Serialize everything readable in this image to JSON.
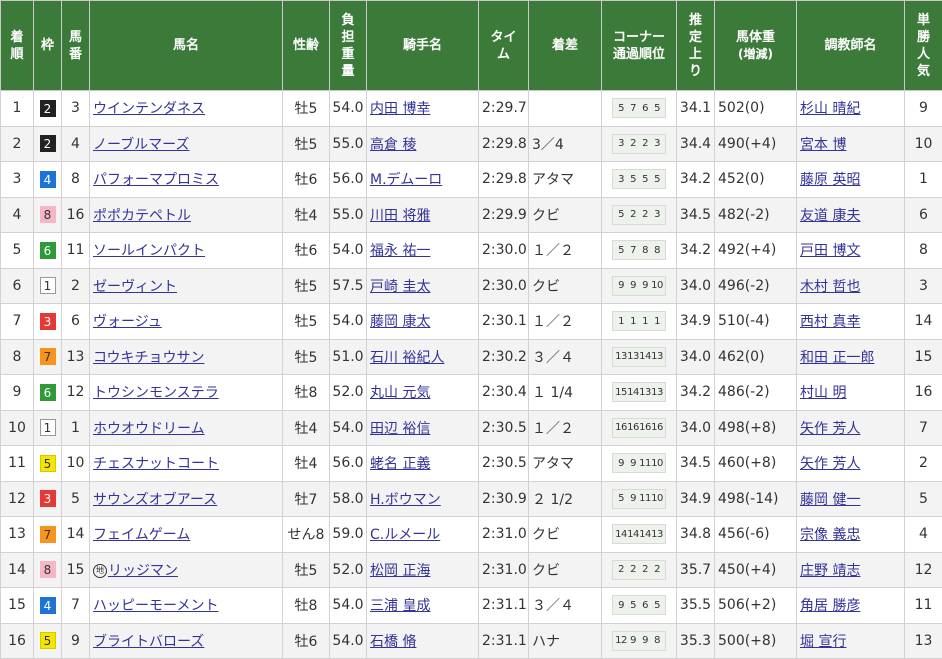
{
  "headers": [
    "着順",
    "枠",
    "馬番",
    "馬名",
    "性齢",
    "負担重量",
    "騎手名",
    "タイム",
    "着差",
    "コーナー通過順位",
    "推定上り",
    "馬体重(増減)",
    "調教師名",
    "単勝人気"
  ],
  "waku_colors": {
    "1": {
      "bg": "#ffffff",
      "fg": "#333333",
      "border": "#999999"
    },
    "2": {
      "bg": "#222222",
      "fg": "#ffffff",
      "border": "#222222"
    },
    "3": {
      "bg": "#e53935",
      "fg": "#ffffff",
      "border": "#e53935"
    },
    "4": {
      "bg": "#1e73d8",
      "fg": "#ffffff",
      "border": "#1e73d8"
    },
    "5": {
      "bg": "#f5e600",
      "fg": "#333333",
      "border": "#d6c800"
    },
    "6": {
      "bg": "#2e9a3a",
      "fg": "#ffffff",
      "border": "#2e9a3a"
    },
    "7": {
      "bg": "#f7941d",
      "fg": "#333333",
      "border": "#f7941d"
    },
    "8": {
      "bg": "#f7b6c8",
      "fg": "#333333",
      "border": "#f7b6c8"
    }
  },
  "rows": [
    {
      "rank": "1",
      "waku": "2",
      "umaban": "3",
      "horse": "ウインテンダネス",
      "chihou": false,
      "sex_age": "牡5",
      "weight": "54.0",
      "jockey": "内田 博幸",
      "time": "2:29.7",
      "margin": "",
      "corners": [
        "5",
        "7",
        "6",
        "5"
      ],
      "last3f": "34.1",
      "body": "502(0)",
      "trainer": "杉山 晴紀",
      "pop": "9"
    },
    {
      "rank": "2",
      "waku": "2",
      "umaban": "4",
      "horse": "ノーブルマーズ",
      "chihou": false,
      "sex_age": "牡5",
      "weight": "55.0",
      "jockey": "高倉 稜",
      "time": "2:29.8",
      "margin": "3／4",
      "corners": [
        "3",
        "2",
        "2",
        "3"
      ],
      "last3f": "34.4",
      "body": "490(+4)",
      "trainer": "宮本 博",
      "pop": "10"
    },
    {
      "rank": "3",
      "waku": "4",
      "umaban": "8",
      "horse": "パフォーマプロミス",
      "chihou": false,
      "sex_age": "牡6",
      "weight": "56.0",
      "jockey": "M.デムーロ",
      "time": "2:29.8",
      "margin": "アタマ",
      "corners": [
        "3",
        "5",
        "5",
        "5"
      ],
      "last3f": "34.2",
      "body": "452(0)",
      "trainer": "藤原 英昭",
      "pop": "1"
    },
    {
      "rank": "4",
      "waku": "8",
      "umaban": "16",
      "horse": "ポポカテペトル",
      "chihou": false,
      "sex_age": "牡4",
      "weight": "55.0",
      "jockey": "川田 将雅",
      "time": "2:29.9",
      "margin": "クビ",
      "corners": [
        "5",
        "2",
        "2",
        "3"
      ],
      "last3f": "34.5",
      "body": "482(-2)",
      "trainer": "友道 康夫",
      "pop": "6"
    },
    {
      "rank": "5",
      "waku": "6",
      "umaban": "11",
      "horse": "ソールインパクト",
      "chihou": false,
      "sex_age": "牡6",
      "weight": "54.0",
      "jockey": "福永 祐一",
      "time": "2:30.0",
      "margin": "１／２",
      "corners": [
        "5",
        "7",
        "8",
        "8"
      ],
      "last3f": "34.2",
      "body": "492(+4)",
      "trainer": "戸田 博文",
      "pop": "8"
    },
    {
      "rank": "6",
      "waku": "1",
      "umaban": "2",
      "horse": "ゼーヴィント",
      "chihou": false,
      "sex_age": "牡5",
      "weight": "57.5",
      "jockey": "戸崎 圭太",
      "time": "2:30.0",
      "margin": "クビ",
      "corners": [
        "9",
        "9",
        "9",
        "10"
      ],
      "last3f": "34.0",
      "body": "496(-2)",
      "trainer": "木村 哲也",
      "pop": "3"
    },
    {
      "rank": "7",
      "waku": "3",
      "umaban": "6",
      "horse": "ヴォージュ",
      "chihou": false,
      "sex_age": "牡5",
      "weight": "54.0",
      "jockey": "藤岡 康太",
      "time": "2:30.1",
      "margin": "１／２",
      "corners": [
        "1",
        "1",
        "1",
        "1"
      ],
      "last3f": "34.9",
      "body": "510(-4)",
      "trainer": "西村 真幸",
      "pop": "14"
    },
    {
      "rank": "8",
      "waku": "7",
      "umaban": "13",
      "horse": "コウキチョウサン",
      "chihou": false,
      "sex_age": "牡5",
      "weight": "51.0",
      "jockey": "石川 裕紀人",
      "time": "2:30.2",
      "margin": "３／４",
      "corners": [
        "13",
        "13",
        "14",
        "13"
      ],
      "last3f": "34.0",
      "body": "462(0)",
      "trainer": "和田 正一郎",
      "pop": "15"
    },
    {
      "rank": "9",
      "waku": "6",
      "umaban": "12",
      "horse": "トウシンモンステラ",
      "chihou": false,
      "sex_age": "牡8",
      "weight": "52.0",
      "jockey": "丸山 元気",
      "time": "2:30.4",
      "margin": "１ 1/4",
      "corners": [
        "15",
        "14",
        "13",
        "13"
      ],
      "last3f": "34.2",
      "body": "486(-2)",
      "trainer": "村山 明",
      "pop": "16"
    },
    {
      "rank": "10",
      "waku": "1",
      "umaban": "1",
      "horse": "ホウオウドリーム",
      "chihou": false,
      "sex_age": "牡4",
      "weight": "54.0",
      "jockey": "田辺 裕信",
      "time": "2:30.5",
      "margin": "１／２",
      "corners": [
        "16",
        "16",
        "16",
        "16"
      ],
      "last3f": "34.0",
      "body": "498(+8)",
      "trainer": "矢作 芳人",
      "pop": "7"
    },
    {
      "rank": "11",
      "waku": "5",
      "umaban": "10",
      "horse": "チェスナットコート",
      "chihou": false,
      "sex_age": "牡4",
      "weight": "56.0",
      "jockey": "蛯名 正義",
      "time": "2:30.5",
      "margin": "アタマ",
      "corners": [
        "9",
        "9",
        "11",
        "10"
      ],
      "last3f": "34.5",
      "body": "460(+8)",
      "trainer": "矢作 芳人",
      "pop": "2"
    },
    {
      "rank": "12",
      "waku": "3",
      "umaban": "5",
      "horse": "サウンズオブアース",
      "chihou": false,
      "sex_age": "牡7",
      "weight": "58.0",
      "jockey": "H.ボウマン",
      "time": "2:30.9",
      "margin": "２ 1/2",
      "corners": [
        "5",
        "9",
        "11",
        "10"
      ],
      "last3f": "34.9",
      "body": "498(-14)",
      "trainer": "藤岡 健一",
      "pop": "5"
    },
    {
      "rank": "13",
      "waku": "7",
      "umaban": "14",
      "horse": "フェイムゲーム",
      "chihou": false,
      "sex_age": "せん8",
      "weight": "59.0",
      "jockey": "C.ルメール",
      "time": "2:31.0",
      "margin": "クビ",
      "corners": [
        "14",
        "14",
        "14",
        "13"
      ],
      "last3f": "34.8",
      "body": "456(-6)",
      "trainer": "宗像 義忠",
      "pop": "4"
    },
    {
      "rank": "14",
      "waku": "8",
      "umaban": "15",
      "horse": "リッジマン",
      "chihou": true,
      "chihou_mark": "地",
      "sex_age": "牡5",
      "weight": "52.0",
      "jockey": "松岡 正海",
      "time": "2:31.0",
      "margin": "クビ",
      "corners": [
        "2",
        "2",
        "2",
        "2"
      ],
      "last3f": "35.7",
      "body": "450(+4)",
      "trainer": "庄野 靖志",
      "pop": "12"
    },
    {
      "rank": "15",
      "waku": "4",
      "umaban": "7",
      "horse": "ハッピーモーメント",
      "chihou": false,
      "sex_age": "牡8",
      "weight": "54.0",
      "jockey": "三浦 皇成",
      "time": "2:31.1",
      "margin": "３／４",
      "corners": [
        "9",
        "5",
        "6",
        "5"
      ],
      "last3f": "35.5",
      "body": "506(+2)",
      "trainer": "角居 勝彦",
      "pop": "11"
    },
    {
      "rank": "16",
      "waku": "5",
      "umaban": "9",
      "horse": "ブライトバローズ",
      "chihou": false,
      "sex_age": "牡6",
      "weight": "54.0",
      "jockey": "石橋 脩",
      "time": "2:31.1",
      "margin": "ハナ",
      "corners": [
        "12",
        "9",
        "9",
        "8"
      ],
      "last3f": "35.3",
      "body": "500(+8)",
      "trainer": "堀 宣行",
      "pop": "13"
    }
  ]
}
